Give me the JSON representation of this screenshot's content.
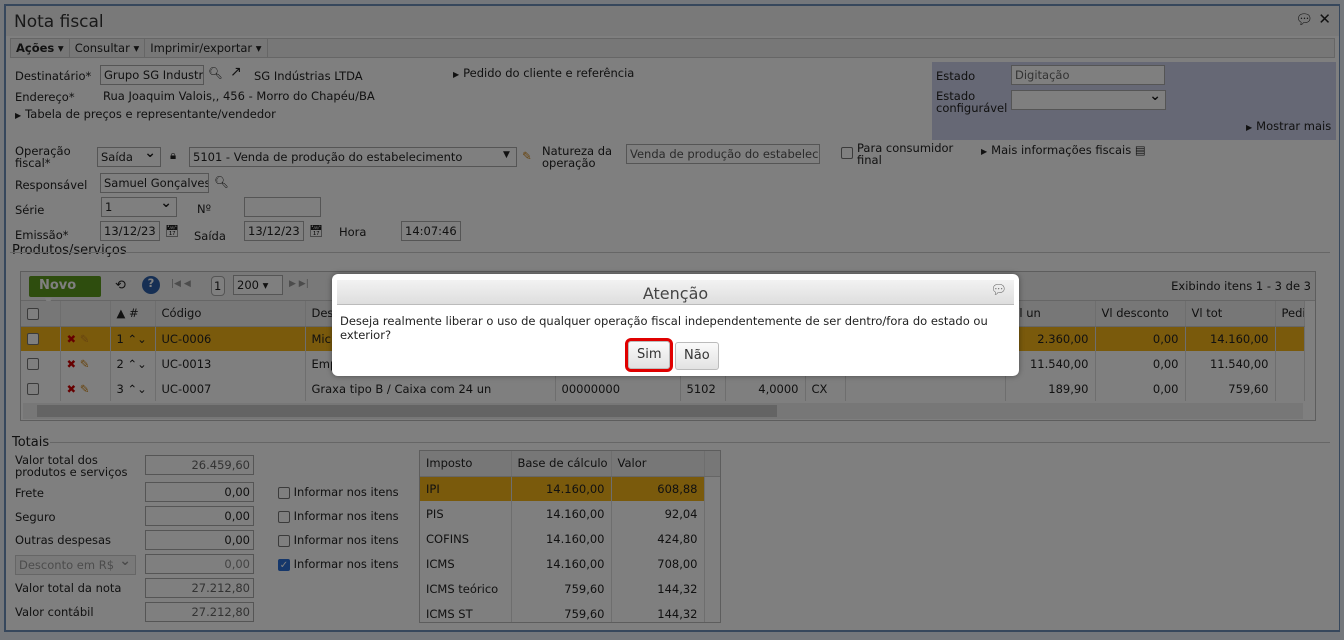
{
  "window": {
    "title": "Nota fiscal"
  },
  "menu": [
    "Ações",
    "Consultar",
    "Imprimir/exportar"
  ],
  "header": {
    "destinatario_label": "Destinatário*",
    "destinatario_value": "Grupo SG Industria",
    "destinatario_name": "SG Indústrias LTDA",
    "endereco_label": "Endereço*",
    "endereco_value": "Rua Joaquim Valois,, 456 - Morro do Chapéu/BA",
    "tabela_link": "Tabela de preços e representante/vendedor",
    "pedido_link": "Pedido do cliente e referência",
    "estado_label": "Estado",
    "estado_value": "Digitação",
    "estado_conf_label": "Estado configurável",
    "estado_conf_value": "",
    "mostrar_mais": "Mostrar mais",
    "operacao_label": "Operação fiscal*",
    "operacao_tipo": "Saída",
    "operacao_value": "5101 - Venda de produção do estabelecimento",
    "natureza_label": "Natureza da operação",
    "natureza_value": "Venda de produção do estabelecimento",
    "consumidor_label": "Para consumidor final",
    "mais_info": "Mais informações fiscais",
    "responsavel_label": "Responsável",
    "responsavel_value": "Samuel Gonçalves",
    "serie_label": "Série",
    "serie_value": "1",
    "numero_label": "Nº",
    "numero_value": "",
    "emissao_label": "Emissão*",
    "emissao_value": "13/12/23",
    "saida_label": "Saída",
    "saida_value": "13/12/23",
    "hora_label": "Hora",
    "hora_value": "14:07:46"
  },
  "products": {
    "section_title": "Produtos/serviços",
    "new_button": "Novo",
    "page": "1",
    "page_size": "200",
    "showing": "Exibindo itens 1 - 3 de 3",
    "columns": [
      "",
      "",
      "#",
      "Código",
      "Des",
      "",
      "",
      "",
      "",
      "",
      "Vl un",
      "Vl desconto",
      "Vl tot",
      "Pedi"
    ],
    "rows": [
      {
        "n": "1",
        "code": "UC-0006",
        "desc": "Mic",
        "ncm": "",
        "cfop": "",
        "qtd": "",
        "un": "",
        "vlun": "2.360,00",
        "desc_v": "0,00",
        "tot": "14.160,00"
      },
      {
        "n": "2",
        "code": "UC-0013",
        "desc": "Emp",
        "ncm": "",
        "cfop": "",
        "qtd": "",
        "un": "",
        "vlun": "11.540,00",
        "desc_v": "0,00",
        "tot": "11.540,00"
      },
      {
        "n": "3",
        "code": "UC-0007",
        "desc": "Graxa tipo B / Caixa com 24 un",
        "ncm": "00000000",
        "cfop": "5102",
        "qtd": "4,0000",
        "un": "CX",
        "vlun": "189,90",
        "desc_v": "0,00",
        "tot": "759,60"
      }
    ]
  },
  "totals": {
    "section_title": "Totais",
    "fields": [
      {
        "label": "Valor total dos produtos e serviços",
        "value": "26.459,60"
      },
      {
        "label": "Frete",
        "value": "0,00",
        "check": "Informar nos itens",
        "checked": false
      },
      {
        "label": "Seguro",
        "value": "0,00",
        "check": "Informar nos itens",
        "checked": false
      },
      {
        "label": "Outras despesas",
        "value": "0,00",
        "check": "Informar nos itens",
        "checked": false
      },
      {
        "label": "Desconto em R$",
        "value": "0,00",
        "check": "Informar nos itens",
        "checked": true
      },
      {
        "label": "Valor total da nota",
        "value": "27.212,80"
      },
      {
        "label": "Valor contábil",
        "value": "27.212,80"
      }
    ],
    "tax_columns": [
      "Imposto",
      "Base de cálculo",
      "Valor"
    ],
    "taxes": [
      {
        "name": "IPI",
        "base": "14.160,00",
        "value": "608,88"
      },
      {
        "name": "PIS",
        "base": "14.160,00",
        "value": "92,04"
      },
      {
        "name": "COFINS",
        "base": "14.160,00",
        "value": "424,80"
      },
      {
        "name": "ICMS",
        "base": "14.160,00",
        "value": "708,00"
      },
      {
        "name": "ICMS teórico",
        "base": "759,60",
        "value": "144,32"
      },
      {
        "name": "ICMS ST",
        "base": "759,60",
        "value": "144,32"
      }
    ]
  },
  "dialog": {
    "title": "Atenção",
    "message": "Deseja realmente liberar o uso de qualquer operação fiscal independentemente de ser dentro/fora do estado ou exterior?",
    "yes": "Sim",
    "no": "Não"
  },
  "colors": {
    "selected_row": "#f5b418",
    "highlight": "#e00000",
    "new_button": "#5c9a1c"
  }
}
